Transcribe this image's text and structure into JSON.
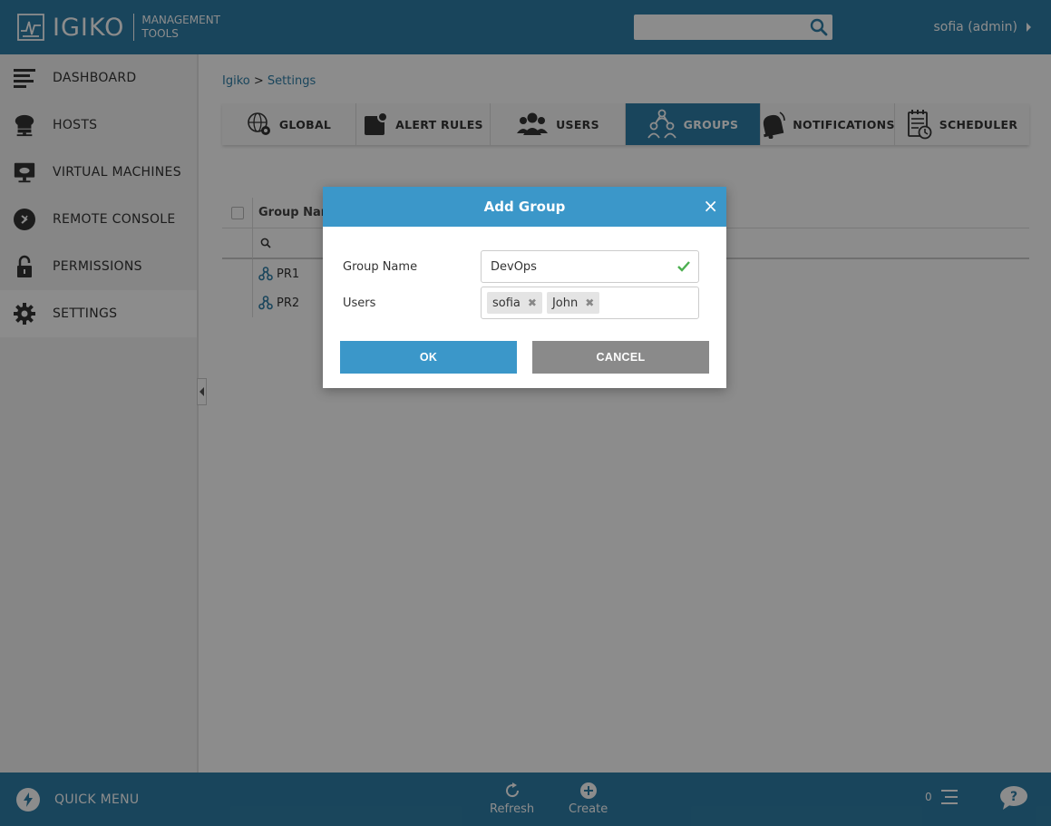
{
  "header": {
    "brand": "IGIKO",
    "brand_sub_line1": "MANAGEMENT",
    "brand_sub_line2": "TOOLS",
    "search_placeholder": "",
    "user_label": "sofia (admin)"
  },
  "sidebar": {
    "items": [
      {
        "label": "DASHBOARD",
        "icon": "dashboard-lines-icon"
      },
      {
        "label": "HOSTS",
        "icon": "hosts-cloud-icon"
      },
      {
        "label": "VIRTUAL MACHINES",
        "icon": "monitor-cloud-icon"
      },
      {
        "label": "REMOTE CONSOLE",
        "icon": "remote-console-icon"
      },
      {
        "label": "PERMISSIONS",
        "icon": "padlock-icon"
      },
      {
        "label": "SETTINGS",
        "icon": "gear-icon",
        "active": true
      }
    ]
  },
  "breadcrumb": {
    "root": "Igiko",
    "separator": ">",
    "current": "Settings"
  },
  "tabs": [
    {
      "label": "GLOBAL",
      "icon": "globe-gear-icon"
    },
    {
      "label": "ALERT RULES",
      "icon": "alert-rules-icon"
    },
    {
      "label": "USERS",
      "icon": "users-icon"
    },
    {
      "label": "GROUPS",
      "icon": "groups-icon",
      "active": true
    },
    {
      "label": "NOTIFICATIONS",
      "icon": "bell-icon"
    },
    {
      "label": "SCHEDULER",
      "icon": "scheduler-icon"
    }
  ],
  "table": {
    "column_group_name": "Group Name",
    "rows": [
      {
        "name": "PR1"
      },
      {
        "name": "PR2"
      }
    ]
  },
  "modal": {
    "title": "Add Group",
    "close": "×",
    "group_name_label": "Group Name",
    "group_name_value": "DevOps",
    "users_label": "Users",
    "users": [
      "sofia",
      "John"
    ],
    "ok_label": "OK",
    "cancel_label": "CANCEL"
  },
  "footer": {
    "quick_menu": "QUICK MENU",
    "refresh": "Refresh",
    "create": "Create",
    "notification_count": "0"
  },
  "colors": {
    "brand": "#2f7fa8",
    "modal_header": "#3b97c9",
    "cancel": "#8a8a8a",
    "check": "#4caf50"
  }
}
